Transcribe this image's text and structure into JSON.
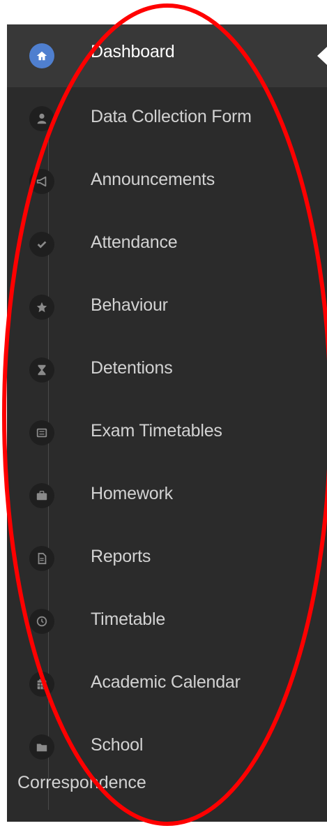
{
  "sidebar": {
    "items": [
      {
        "label": "Dashboard",
        "icon": "home-icon",
        "active": true
      },
      {
        "label": "Data Collection Form",
        "icon": "user-icon"
      },
      {
        "label": "Announcements",
        "icon": "megaphone-icon"
      },
      {
        "label": "Attendance",
        "icon": "check-icon"
      },
      {
        "label": "Behaviour",
        "icon": "star-icon"
      },
      {
        "label": "Detentions",
        "icon": "hourglass-icon"
      },
      {
        "label": "Exam Timetables",
        "icon": "list-icon"
      },
      {
        "label": "Homework",
        "icon": "briefcase-icon"
      },
      {
        "label": "Reports",
        "icon": "document-icon"
      },
      {
        "label": "Timetable",
        "icon": "clock-icon"
      },
      {
        "label": "Academic Calendar",
        "icon": "calendar-icon"
      },
      {
        "label": "School",
        "label_cont": "Correspondence",
        "icon": "folder-icon"
      }
    ]
  },
  "colors": {
    "sidebar_bg": "#2b2b2b",
    "active_bg": "#383838",
    "active_icon_bg": "#4f7fcf",
    "text": "#d2d2d2",
    "annotation": "#ff0000"
  }
}
